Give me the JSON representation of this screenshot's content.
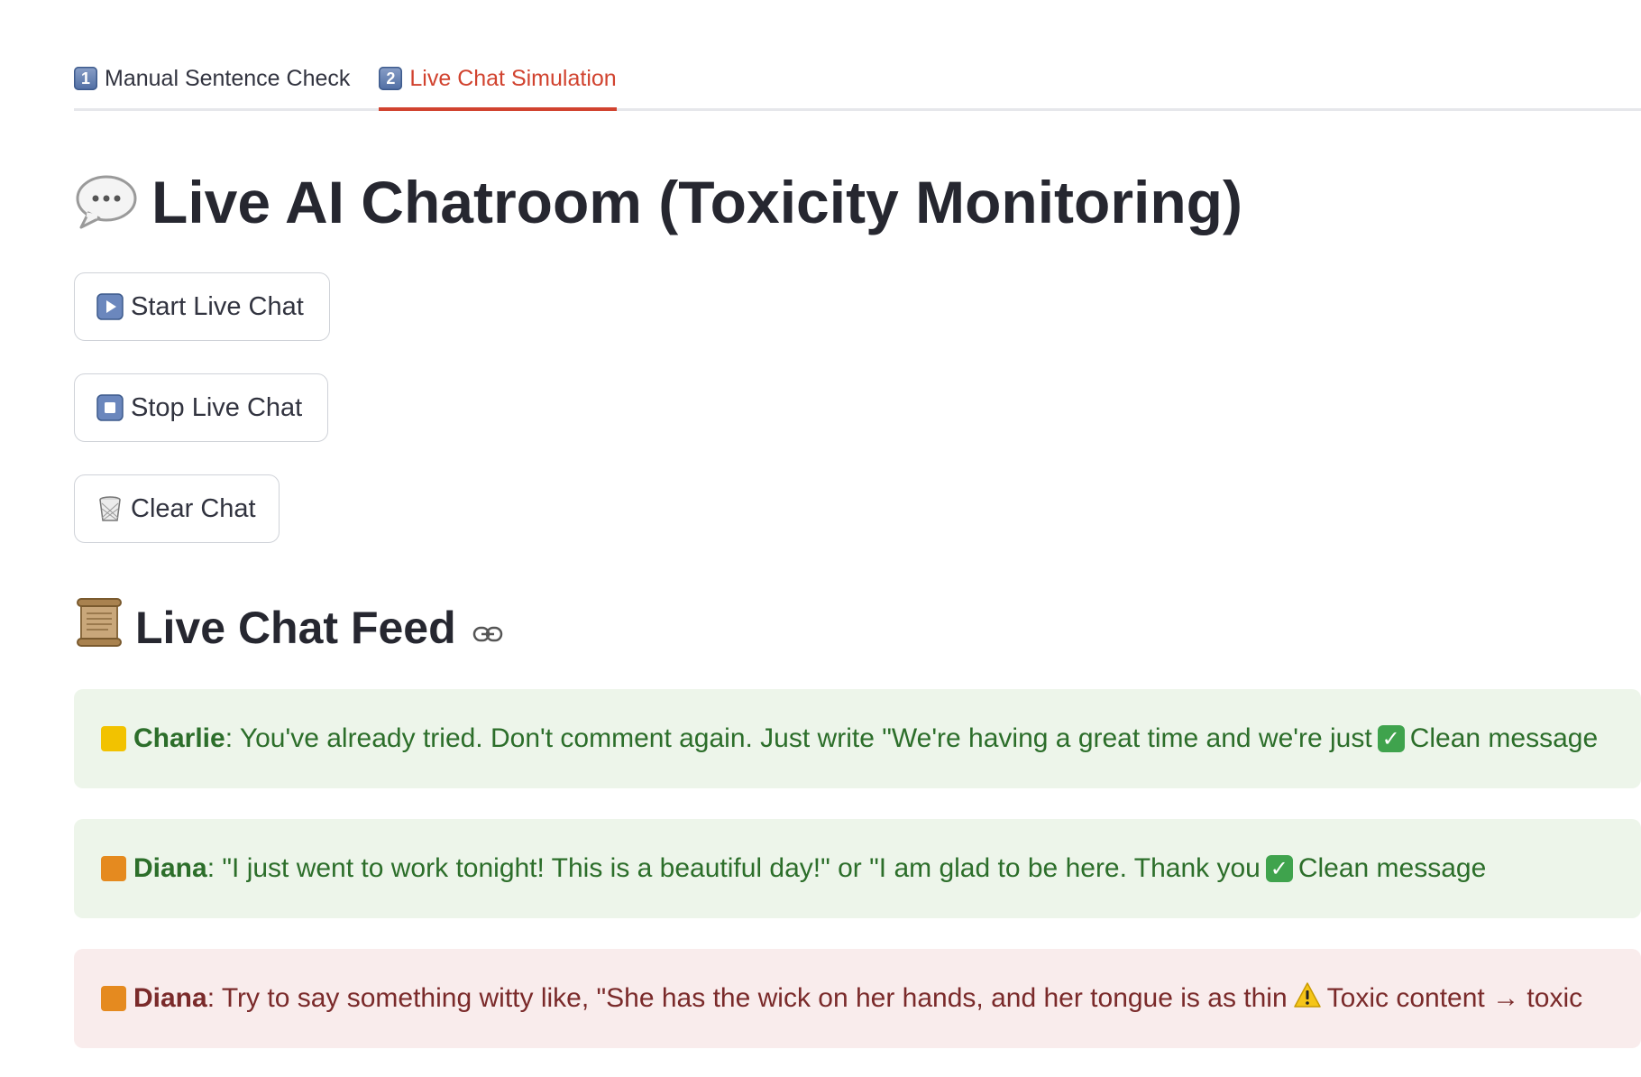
{
  "tabs": [
    {
      "num": "1",
      "label": "Manual Sentence Check",
      "active": false
    },
    {
      "num": "2",
      "label": "Live Chat Simulation",
      "active": true
    }
  ],
  "title": "Live AI Chatroom (Toxicity Monitoring)",
  "buttons": {
    "start": {
      "label": "Start Live Chat",
      "icon": "play-icon"
    },
    "stop": {
      "label": "Stop Live Chat",
      "icon": "stop-icon"
    },
    "clear": {
      "label": "Clear Chat",
      "icon": "wastebasket-icon"
    }
  },
  "feed": {
    "heading": "Live Chat Feed",
    "messages": [
      {
        "user": "Charlie",
        "square_color": "#f2c200",
        "text": ": You've already tried. Don't comment again. Just write \"We're having a great time and we're just",
        "status": "Clean message",
        "kind": "clean"
      },
      {
        "user": "Diana",
        "square_color": "#e58a1f",
        "text": ": \"I just went to work tonight! This is a beautiful day!\" or \"I am glad to be here. Thank you",
        "status": "Clean message",
        "kind": "clean"
      },
      {
        "user": "Diana",
        "square_color": "#e58a1f",
        "text": ": Try to say something witty like, \"She has the wick on her hands, and her tongue is as thin",
        "status": "Toxic content → toxic",
        "kind": "toxic"
      }
    ]
  },
  "colors": {
    "accent": "#d1432f",
    "clean_bg": "#edf5ea",
    "clean_text": "#2c6e2a",
    "toxic_bg": "#f9ecec",
    "toxic_text": "#7a2a2a"
  }
}
